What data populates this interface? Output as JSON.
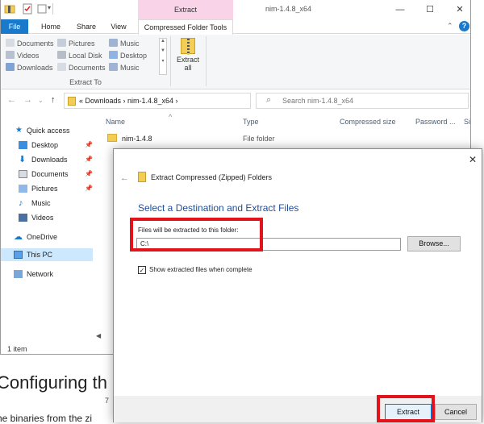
{
  "webpage": {
    "heading": "Configuring th",
    "paragraph": "he binaries from the zi",
    "side_fragments": [
      "Size",
      "7"
    ]
  },
  "window": {
    "title": "nim-1.4.8_x64",
    "contextual_group": "Extract",
    "controls": [
      "—",
      "☐",
      "✕"
    ]
  },
  "tabs": {
    "file": "File",
    "home": "Home",
    "share": "Share",
    "view": "View",
    "compressed": "Compressed Folder Tools"
  },
  "ribbon": {
    "col1": [
      "Documents",
      "Videos",
      "Downloads"
    ],
    "col2": [
      "Pictures",
      "Local Disk",
      "Documents"
    ],
    "col3": [
      "Music",
      "Desktop",
      "Music"
    ],
    "group_label": "Extract To",
    "extract_all_line1": "Extract",
    "extract_all_line2": "all"
  },
  "address": {
    "crumbs": "«  Downloads  ›  nim-1.4.8_x64  ›",
    "search_placeholder": "Search nim-1.4.8_x64"
  },
  "navpane": {
    "quick_access": "Quick access",
    "items": [
      "Desktop",
      "Downloads",
      "Documents",
      "Pictures",
      "Music",
      "Videos"
    ],
    "onedrive": "OneDrive",
    "this_pc": "This PC",
    "network": "Network"
  },
  "columns": [
    "Name",
    "Type",
    "Compressed size",
    "Password ...",
    "Size"
  ],
  "files": [
    {
      "name": "nim-1.4.8",
      "type": "File folder"
    }
  ],
  "status": "1 item",
  "dialog": {
    "title": "Extract Compressed (Zipped) Folders",
    "heading": "Select a Destination and Extract Files",
    "path_label": "Files will be extracted to this folder:",
    "path_value": "C:\\",
    "browse": "Browse...",
    "show_files_label": "Show extracted files when complete",
    "show_files_checked": true,
    "extract": "Extract",
    "cancel": "Cancel"
  },
  "colors": {
    "accent": "#1979ca",
    "context_tab": "#f9d3e8",
    "heading_blue": "#1f4e96",
    "highlight_red": "#e3131b",
    "selection": "#cce8ff"
  }
}
